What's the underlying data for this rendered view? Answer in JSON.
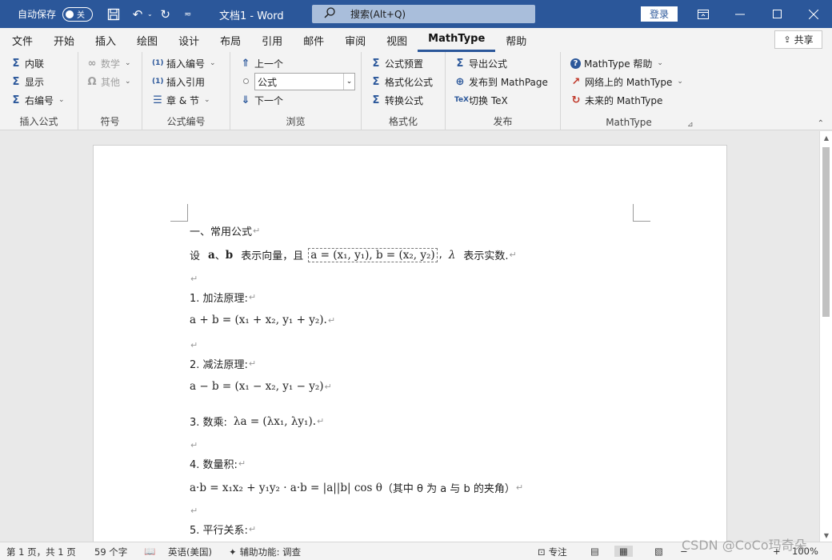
{
  "titlebar": {
    "autosave_label": "自动保存",
    "autosave_state": "关",
    "doc_title": "文档1  -  Word",
    "search_placeholder": "搜索(Alt+Q)",
    "login_label": "登录",
    "icons": [
      "save-icon",
      "undo-icon",
      "redo-icon",
      "customize-icon",
      "ribbon-display-icon",
      "minimize-icon",
      "maximize-icon",
      "close-icon"
    ]
  },
  "tabs": [
    "文件",
    "开始",
    "插入",
    "绘图",
    "设计",
    "布局",
    "引用",
    "邮件",
    "审阅",
    "视图",
    "MathType",
    "帮助"
  ],
  "active_tab": "MathType",
  "share_label": "共享",
  "ribbon": {
    "insert_formula": {
      "label": "插入公式",
      "items": [
        "内联",
        "显示",
        "右编号"
      ]
    },
    "symbols": {
      "label": "符号",
      "items": [
        "数学",
        "其他"
      ]
    },
    "numbering": {
      "label": "公式编号",
      "items": [
        "插入编号",
        "插入引用",
        "章 & 节"
      ]
    },
    "browse": {
      "label": "浏览",
      "prev": "上一个",
      "combo_value": "公式",
      "next": "下一个"
    },
    "format": {
      "label": "格式化",
      "items": [
        "公式预置",
        "格式化公式",
        "转换公式"
      ]
    },
    "publish": {
      "label": "发布",
      "items": [
        "导出公式",
        "发布到 MathPage",
        "切换 TeX"
      ]
    },
    "mathtype": {
      "label": "MathType",
      "items": [
        "MathType 帮助",
        "网络上的 MathType",
        "未来的 MathType"
      ]
    }
  },
  "document": {
    "heading": "一、常用公式",
    "intro_prefix": "设",
    "intro_a": "a",
    "intro_sep": "、",
    "intro_b": "b",
    "intro_mid": "表示向量，且",
    "intro_math": "a = (x₁, y₁), b = (x₂, y₂)",
    "intro_lambda": "λ",
    "intro_suffix": "表示实数.",
    "item1_title": "1. 加法原理:",
    "item1_math": "a + b = (x₁ + x₂, y₁ + y₂).",
    "item2_title": "2. 减法原理:",
    "item2_math": "a − b = (x₁ − x₂, y₁ − y₂)",
    "item3_title": "3. 数乘:",
    "item3_math": "λa = (λx₁, λy₁).",
    "item4_title": "4. 数量积:",
    "item4_math": "a·b = x₁x₂ + y₁y₂ · a·b = |a||b| cos θ",
    "item4_note": "（其中  θ  为  a  与  b  的夹角）",
    "item5_title": "5. 平行关系:"
  },
  "statusbar": {
    "page": "第 1 页，共 1 页",
    "words": "59 个字",
    "language": "英语(美国)",
    "accessibility": "辅助功能: 调查",
    "focus": "专注",
    "zoom": "100%"
  },
  "watermark": "CSDN @CoCo玛奇朵",
  "colors": {
    "titlebar": "#2b579a",
    "ribbon_bg": "#f3f3f3",
    "accent": "#2b579a"
  }
}
